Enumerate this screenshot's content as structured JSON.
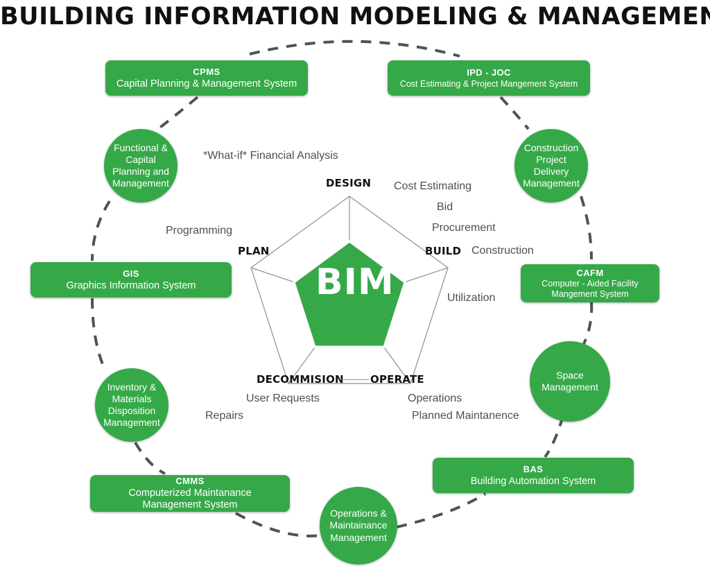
{
  "title": "BUILDING INFORMATION MODELING & MANAGEMENT",
  "center": {
    "label": "BIM"
  },
  "colors": {
    "green": "#35a948",
    "dashed_arc": "#4e5356",
    "text_dark": "#111111",
    "text_body": "#4a4f54",
    "white": "#ffffff"
  },
  "stages": [
    {
      "id": "design",
      "label": "DESIGN"
    },
    {
      "id": "build",
      "label": "BUILD"
    },
    {
      "id": "operate",
      "label": "OPERATE"
    },
    {
      "id": "decommision",
      "label": "DECOMMISION"
    },
    {
      "id": "plan",
      "label": "PLAN"
    }
  ],
  "annotations": [
    {
      "id": "what-if",
      "text": "*What-if* Financial Analysis"
    },
    {
      "id": "programming",
      "text": "Programming"
    },
    {
      "id": "cost-estimating",
      "text": "Cost Estimating"
    },
    {
      "id": "bid",
      "text": "Bid"
    },
    {
      "id": "procurement",
      "text": "Procurement"
    },
    {
      "id": "construction",
      "text": "Construction"
    },
    {
      "id": "utilization",
      "text": "Utilization"
    },
    {
      "id": "operations",
      "text": "Operations"
    },
    {
      "id": "planned-maintanence",
      "text": "Planned Maintanence"
    },
    {
      "id": "user-requests",
      "text": "User Requests"
    },
    {
      "id": "repairs",
      "text": "Repairs"
    }
  ],
  "boxes": [
    {
      "id": "cpms",
      "acronym": "CPMS",
      "full": "Capital Planning & Management System"
    },
    {
      "id": "ipd-joc",
      "acronym": "IPD - JOC",
      "full": "Cost Estimating & Project Mangement System"
    },
    {
      "id": "gis",
      "acronym": "GIS",
      "full": "Graphics Information System"
    },
    {
      "id": "cafm",
      "acronym": "CAFM",
      "full_line1": "Computer - Aided Facility",
      "full_line2": "Mangement System"
    },
    {
      "id": "cmms",
      "acronym": "CMMS",
      "full_line1": "Computerized Maintanance",
      "full_line2": "Management System"
    },
    {
      "id": "bas",
      "acronym": "BAS",
      "full": "Building Automation System"
    }
  ],
  "circles": [
    {
      "id": "functional-capital-planning",
      "line1": "Functional &",
      "line2": "Capital",
      "line3": "Planning and",
      "line4": "Management"
    },
    {
      "id": "construction-project-delivery",
      "line1": "Construction",
      "line2": "Project",
      "line3": "Delivery",
      "line4": "Management"
    },
    {
      "id": "inventory-materials-disposition",
      "line1": "Inventory &",
      "line2": "Materials",
      "line3": "Disposition",
      "line4": "Management"
    },
    {
      "id": "space-management",
      "line1": "Space",
      "line2": "Management"
    },
    {
      "id": "operations-maintainance",
      "line1": "Operations &",
      "line2": "Maintainance",
      "line3": "Management"
    }
  ]
}
